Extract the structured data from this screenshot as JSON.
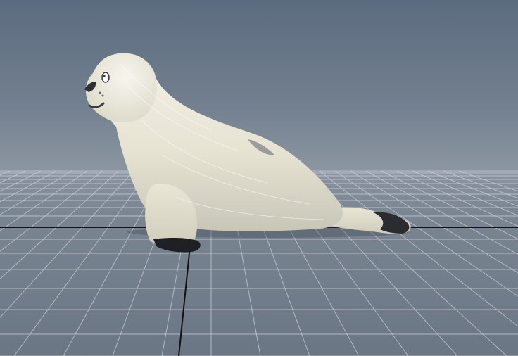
{
  "viewport": {
    "background_top": "#5b6c7f",
    "background_horizon": "#8b95a1",
    "grid_line_color": "#c9ced6",
    "axis_line_color": "#111111",
    "scene_object": "harp-seal-pup-model"
  }
}
